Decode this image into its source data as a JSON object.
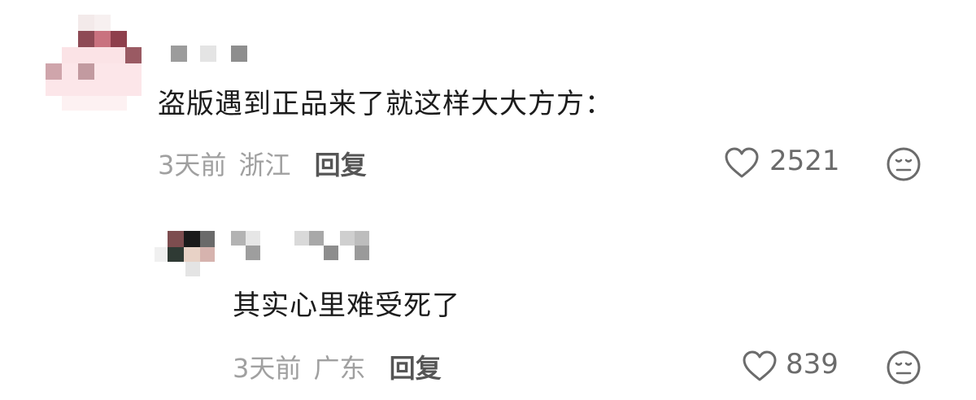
{
  "comments": [
    {
      "text": "盗版遇到正品来了就这样大大方方：",
      "time": "3天前",
      "location": "浙江",
      "reply_label": "回复",
      "like_count": "2521"
    },
    {
      "text": "其实心里难受死了",
      "time": "3天前",
      "location": "广东",
      "reply_label": "回复",
      "like_count": "839"
    }
  ],
  "icons": {
    "like": "heart-outline-icon",
    "dislike": "neutral-face-icon"
  },
  "colors": {
    "text": "#1c1c1c",
    "meta": "#a0a0a0",
    "reply": "#555555",
    "icon": "#6b6b6b"
  }
}
